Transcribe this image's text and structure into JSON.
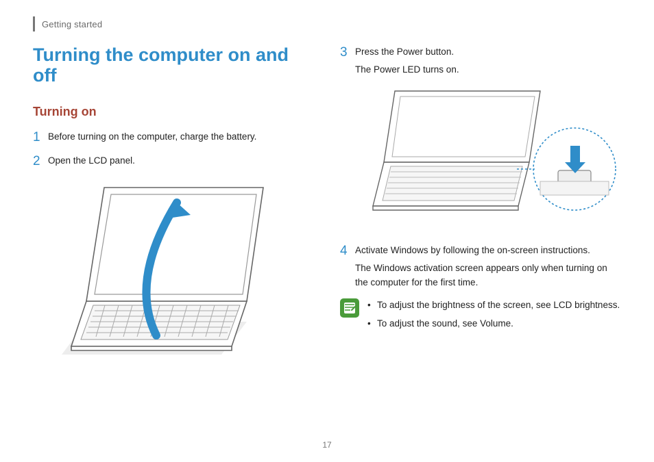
{
  "header": {
    "section": "Getting started"
  },
  "title": "Turning the computer on and off",
  "subhead": "Turning on",
  "left_steps": [
    {
      "num": "1",
      "text": "Before turning on the computer, charge the battery."
    },
    {
      "num": "2",
      "text": "Open the LCD panel."
    }
  ],
  "right_steps": [
    {
      "num": "3",
      "text": "Press the Power button.",
      "extra": "The Power LED turns on."
    },
    {
      "num": "4",
      "text": "Activate Windows by following the on-screen instructions.",
      "extra": "The Windows activation screen appears only when turning on the computer for the first time."
    }
  ],
  "notes": [
    "To adjust the brightness of the screen, see LCD brightness.",
    "To adjust the sound, see Volume."
  ],
  "page_number": "17"
}
